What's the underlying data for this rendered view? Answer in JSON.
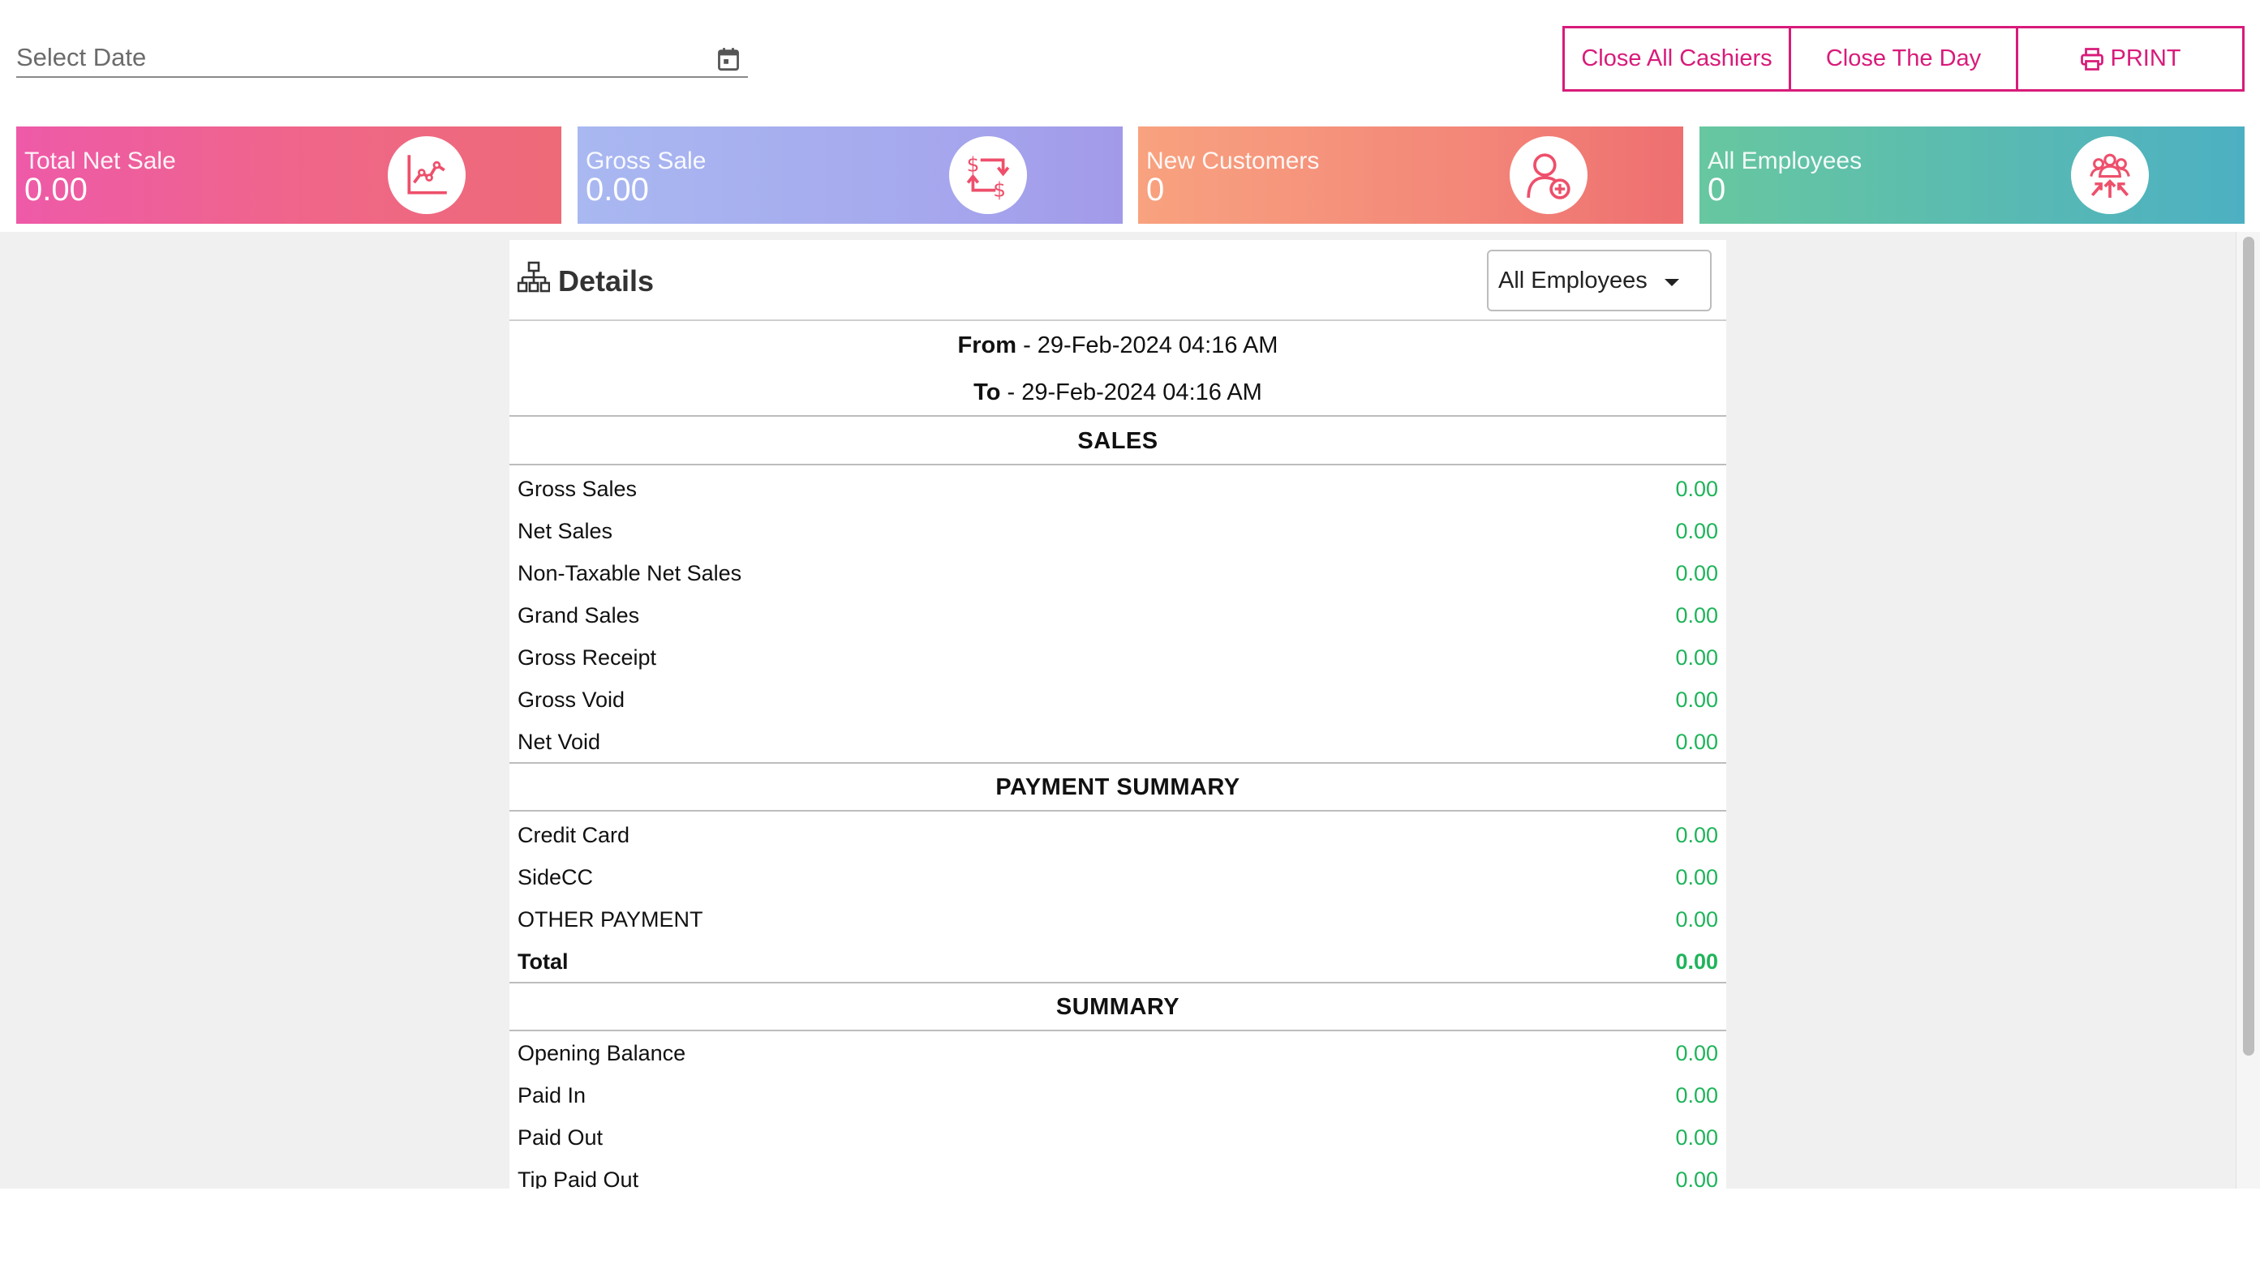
{
  "toolbar": {
    "date_placeholder": "Select Date",
    "close_cashiers_label": "Close All Cashiers",
    "close_day_label": "Close The Day",
    "print_label": "PRINT"
  },
  "stats": [
    {
      "label": "Total Net Sale",
      "value": "0.00",
      "icon": "line-chart-icon"
    },
    {
      "label": "Gross Sale",
      "value": "0.00",
      "icon": "dollar-exchange-icon"
    },
    {
      "label": "New Customers",
      "value": "0",
      "icon": "add-user-icon"
    },
    {
      "label": "All Employees",
      "value": "0",
      "icon": "team-icon"
    }
  ],
  "details": {
    "title": "Details",
    "employee_filter": "All Employees",
    "from_label": "From",
    "from_value": " - 29-Feb-2024 04:16 AM",
    "to_label": "To",
    "to_value": " - 29-Feb-2024 04:16 AM"
  },
  "sections": {
    "sales": {
      "title": "SALES",
      "rows": [
        {
          "label": "Gross Sales",
          "value": "0.00"
        },
        {
          "label": "Net Sales",
          "value": "0.00"
        },
        {
          "label": "Non-Taxable Net Sales",
          "value": "0.00"
        },
        {
          "label": "Grand Sales",
          "value": "0.00"
        },
        {
          "label": "Gross Receipt",
          "value": "0.00"
        },
        {
          "label": "Gross Void",
          "value": "0.00"
        },
        {
          "label": "Net Void",
          "value": "0.00"
        }
      ]
    },
    "payment": {
      "title": "PAYMENT SUMMARY",
      "rows": [
        {
          "label": "Credit Card",
          "value": "0.00"
        },
        {
          "label": "SideCC",
          "value": "0.00"
        },
        {
          "label": "OTHER PAYMENT",
          "value": "0.00"
        },
        {
          "label": "Total",
          "value": "0.00"
        }
      ]
    },
    "summary": {
      "title": "SUMMARY",
      "rows": [
        {
          "label": "Opening Balance",
          "value": "0.00"
        },
        {
          "label": "Paid In",
          "value": "0.00"
        },
        {
          "label": "Paid Out",
          "value": "0.00"
        },
        {
          "label": "Tip Paid Out",
          "value": "0.00"
        }
      ]
    }
  },
  "colors": {
    "accent": "#d81b7a",
    "value_green": "#1fb45a"
  }
}
